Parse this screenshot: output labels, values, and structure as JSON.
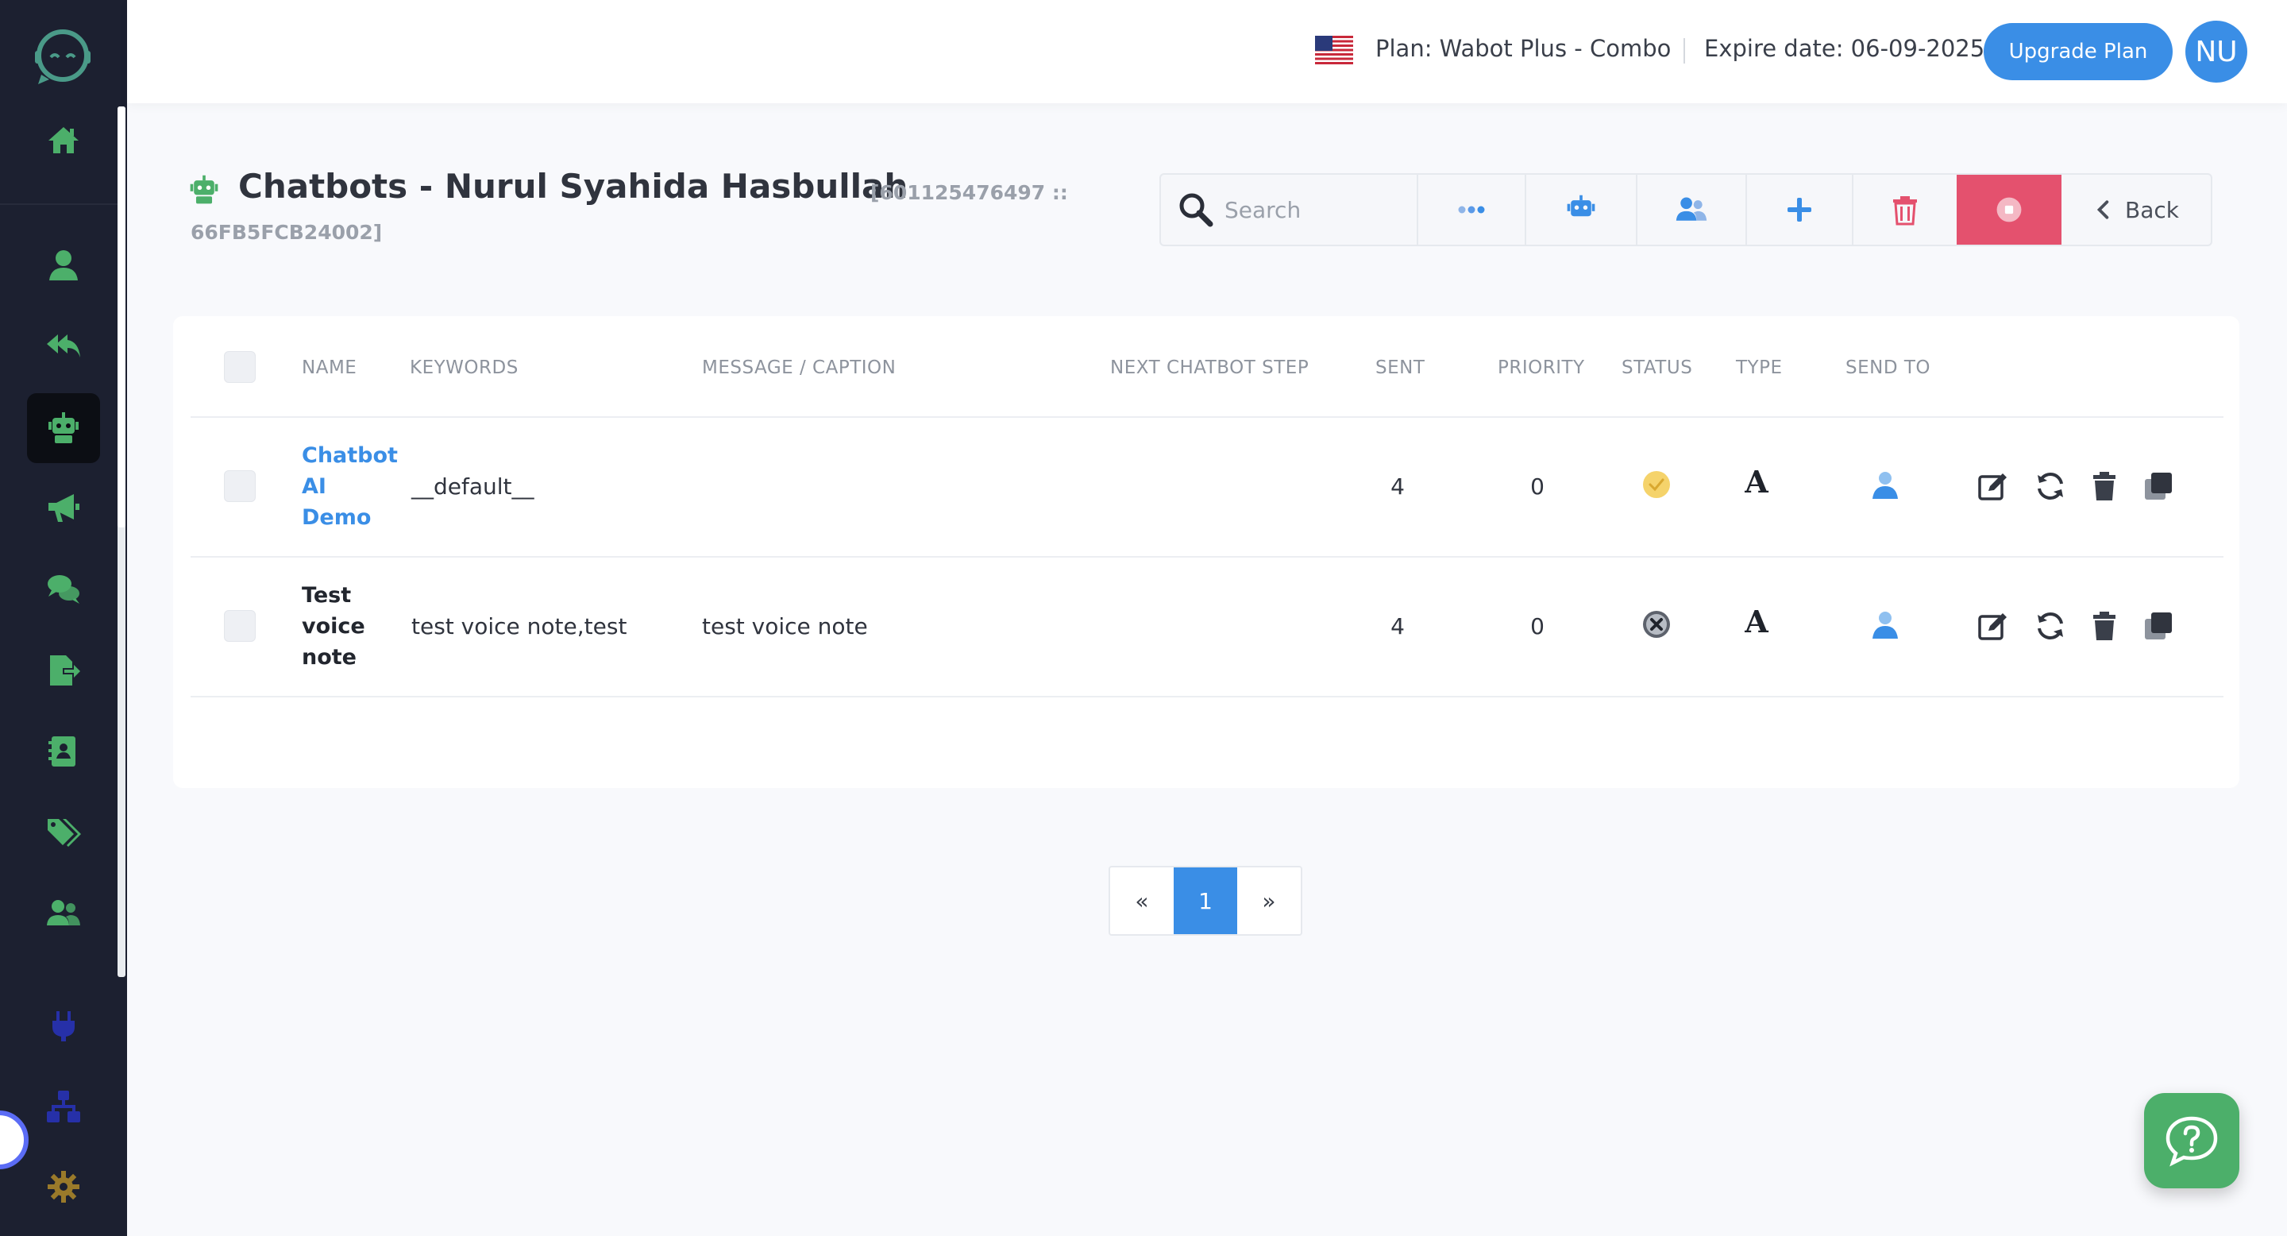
{
  "topbar": {
    "plan": "Plan: Wabot Plus - Combo",
    "expire": "Expire date: 06-09-2025",
    "upgrade_label": "Upgrade Plan",
    "avatar_initials": "NU"
  },
  "header": {
    "title": "Chatbots - Nurul Syahida Hasbullah",
    "id_line1": "[601125476497 ::",
    "id_line2": "66FB5FCB24002]"
  },
  "toolbar": {
    "search_placeholder": "Search",
    "back_label": "Back"
  },
  "table": {
    "headers": [
      "NAME",
      "KEYWORDS",
      "MESSAGE / CAPTION",
      "NEXT CHATBOT STEP",
      "SENT",
      "PRIORITY",
      "STATUS",
      "TYPE",
      "SEND TO"
    ],
    "rows": [
      {
        "name_lines": [
          "Chatbot",
          "AI",
          "Demo"
        ],
        "keywords": "__default__",
        "message": "",
        "next_step": "",
        "sent": "4",
        "priority": "0",
        "status": "active",
        "type": "A"
      },
      {
        "name_lines": [
          "Test",
          "voice",
          "note"
        ],
        "keywords": "test voice note,test",
        "message": "test voice note",
        "next_step": "",
        "sent": "4",
        "priority": "0",
        "status": "inactive",
        "type": "A"
      }
    ]
  },
  "pagination": {
    "prev": "«",
    "current": "1",
    "next": "»"
  },
  "colors": {
    "accent": "#3a8ee6",
    "sidebar_bg": "#1c2030",
    "nav_green": "#4caf6a",
    "danger": "#e4516e",
    "status_active": "#f5d36b",
    "status_inactive": "#6b7078"
  }
}
